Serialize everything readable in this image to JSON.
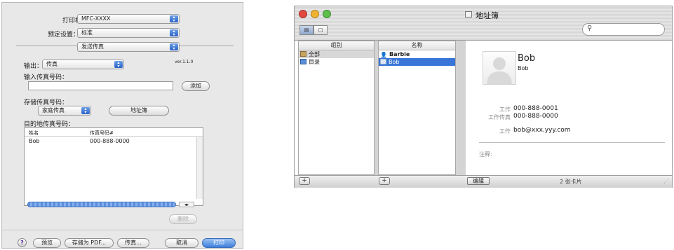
{
  "print_dialog": {
    "printer_label": "打印机：",
    "printer_value": "MFC-XXXX",
    "presets_label": "预定设置：",
    "presets_value": "标准",
    "panel_value": "发送传真",
    "output_label": "输出：",
    "output_value": "传真",
    "version": "ver.1.1.0",
    "input_fax_label": "输入传真号码：",
    "input_fax_value": "",
    "add_button": "添加",
    "stored_fax_label": "存储传真号码：",
    "stored_fax_value": "家庭传真",
    "address_book_button": "地址簿",
    "destination_label": "目的地传真号码：",
    "table_headers": [
      "姓名",
      "传真号码#"
    ],
    "table_rows": [
      {
        "name": "Bob",
        "fax": "000-888-0000"
      }
    ],
    "delete_button": "删除",
    "help": "?",
    "preview_button": "预览",
    "save_pdf_button": "存储为 PDF...",
    "fax_button": "传真...",
    "cancel_button": "取消",
    "print_button": "打印"
  },
  "address_book": {
    "window_title": "地址簿",
    "search_placeholder": "",
    "groups_header": "组别",
    "groups": [
      "全部",
      "目录"
    ],
    "names_header": "名称",
    "names": [
      "Barbie",
      "Bob"
    ],
    "card": {
      "name": "Bob",
      "company": "Bob",
      "fields": [
        {
          "label": "工作",
          "value": "000-888-0001"
        },
        {
          "label": "工作传真",
          "value": "000-888-0000"
        },
        {
          "label": "工作",
          "value": "bob@xxx.yyy.com"
        }
      ],
      "note_label": "注释:"
    },
    "edit_button": "编辑",
    "card_count": "2 张卡片"
  },
  "colors": {
    "selection": "#3875d7",
    "default_button": "#3d7fdc",
    "close_light": "#e2473f",
    "minimize_light": "#f0b233",
    "zoom_light": "#5fbe4c"
  }
}
